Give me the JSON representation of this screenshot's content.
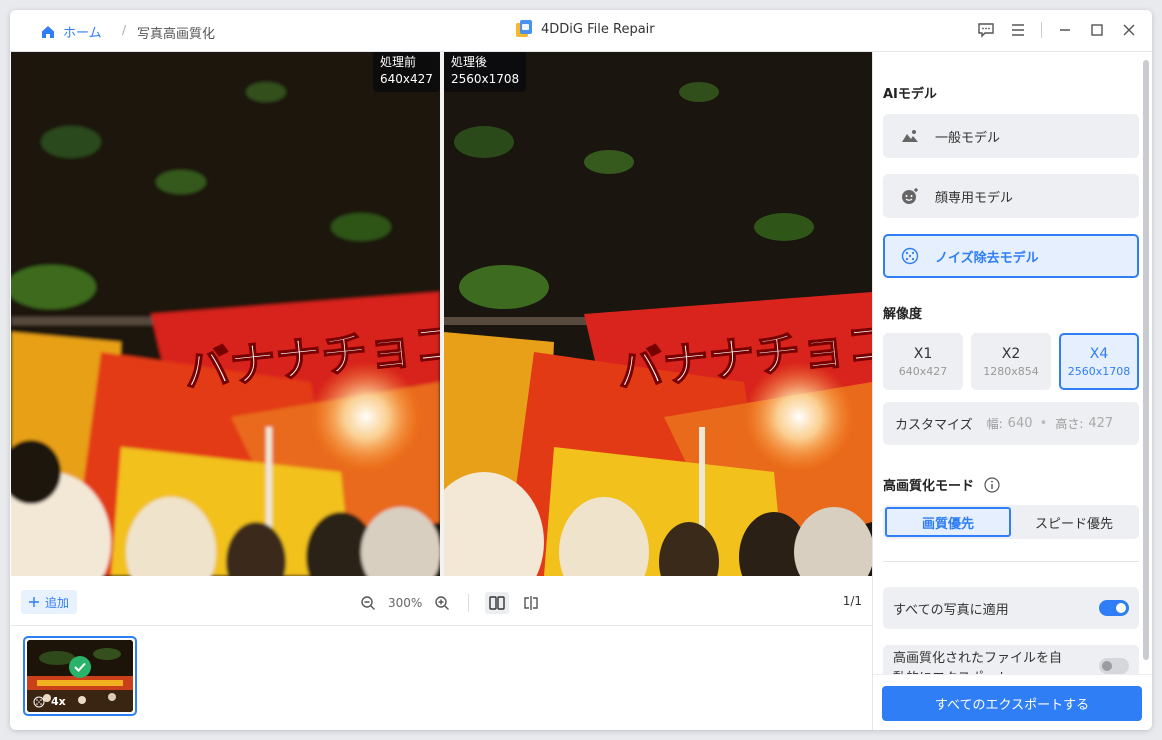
{
  "titlebar": {
    "home_label": "ホーム",
    "separator": "/",
    "current_page": "写真高画質化",
    "app_title": "4DDiG File Repair"
  },
  "viewer": {
    "before_label": "処理前",
    "before_size": "640x427",
    "after_label": "処理後",
    "after_size": "2560x1708",
    "sign_text": "バナナチョコレート"
  },
  "toolbar": {
    "add_label": "追加",
    "zoom_value": "300%",
    "page_indicator": "1/1"
  },
  "thumbnail": {
    "scale_label": "4x"
  },
  "panel": {
    "ai_model_title": "AIモデル",
    "models": [
      {
        "label": "一般モデル",
        "icon": "landscape-icon",
        "active": false
      },
      {
        "label": "顔専用モデル",
        "icon": "face-icon",
        "active": false
      },
      {
        "label": "ノイズ除去モデル",
        "icon": "denoise-icon",
        "active": true
      }
    ],
    "resolution_title": "解像度",
    "resolutions": [
      {
        "label": "X1",
        "size": "640x427",
        "active": false
      },
      {
        "label": "X2",
        "size": "1280x854",
        "active": false
      },
      {
        "label": "X4",
        "size": "2560x1708",
        "active": true
      }
    ],
    "custom": {
      "label": "カスタマイズ",
      "width_key": "幅:",
      "width_value": "640",
      "height_key": "高さ:",
      "height_value": "427"
    },
    "mode_title": "高画質化モード",
    "modes": [
      {
        "label": "画質優先",
        "active": true
      },
      {
        "label": "スピード優先",
        "active": false
      }
    ],
    "apply_all_label": "すべての写真に適用",
    "apply_all_on": true,
    "auto_export_label": "高画質化されたファイルを自動的にエクスポート",
    "auto_export_on": false,
    "export_button": "すべてのエクスポートする"
  },
  "colors": {
    "accent": "#2f7ef5",
    "success": "#29b36a"
  }
}
